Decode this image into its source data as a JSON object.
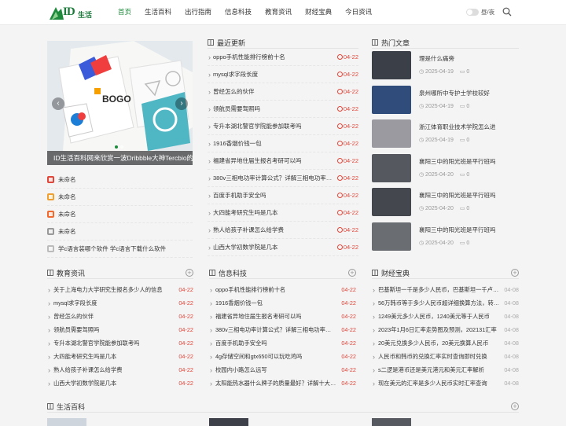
{
  "header": {
    "logo_text": "ID",
    "logo_sub": "生活",
    "nav": [
      "首页",
      "生活百科",
      "出行指南",
      "信息科技",
      "教育资讯",
      "财经宝典",
      "今日资讯"
    ],
    "day_night": "昼/夜",
    "accent": "#1e8b3c"
  },
  "slider": {
    "caption": "ID生活百科网来欣赏一波Dribbble大神Tercbio的作品",
    "prev": "‹",
    "next": "›"
  },
  "sidelist": [
    {
      "label": "未命名",
      "color": "#e0463a"
    },
    {
      "label": "未命名",
      "color": "#f0a030"
    },
    {
      "label": "未命名",
      "color": "#f06a30"
    },
    {
      "label": "未命名",
      "color": "#999999"
    },
    {
      "label": "学c语言装哪个软件 学c语言下载什么软件",
      "color": "#bbbbbb"
    }
  ],
  "latest": {
    "title": "最近更新",
    "items": [
      {
        "t": "oppo手机性能排行榜前十名",
        "d": "04-22"
      },
      {
        "t": "mysql求字段长度",
        "d": "04-22"
      },
      {
        "t": "曾经怎么的伙伴",
        "d": "04-22"
      },
      {
        "t": "领航员需要驾照吗",
        "d": "04-22"
      },
      {
        "t": "专升本湖北警官学院能参加联考吗",
        "d": "04-22"
      },
      {
        "t": "1916香烟价钱一包",
        "d": "04-22"
      },
      {
        "t": "福建省异地住届生报名考研可以吗",
        "d": "04-22"
      },
      {
        "t": "380v三相电功率计算公式？详解三相电功率的计算方法",
        "d": "04-22"
      },
      {
        "t": "百度手机助手安全吗",
        "d": "04-22"
      },
      {
        "t": "大四能考研究生吗是几本",
        "d": "04-22"
      },
      {
        "t": "熟人给孩子补课怎么给学费",
        "d": "04-22"
      },
      {
        "t": "山西大学初数学院是几本",
        "d": "04-22"
      }
    ]
  },
  "hot": {
    "title": "热门文章",
    "items": [
      {
        "t": "理是什么痛旁",
        "date": "2025-04-19",
        "c": "0",
        "bg": "#3a3f48"
      },
      {
        "t": "泉州哪所中专护士学校较好",
        "date": "2025-04-19",
        "c": "0",
        "bg": "#2f4c7a"
      },
      {
        "t": "浙江体育职业技术学院怎么进",
        "date": "2025-04-19",
        "c": "0",
        "bg": "#9a9aa0"
      },
      {
        "t": "襄阳三中的阳光班是平行班吗",
        "date": "2025-04-20",
        "c": "0",
        "bg": "#55585e"
      },
      {
        "t": "襄阳三中的阳光班是平行班吗",
        "date": "2025-04-20",
        "c": "0",
        "bg": "#44474d"
      },
      {
        "t": "襄阳三中的阳光班是平行班吗",
        "date": "2025-04-20",
        "c": "0",
        "bg": "#6a6d72"
      }
    ]
  },
  "edu": {
    "title": "教育资讯",
    "items": [
      {
        "t": "关于上海电力大学研究生报名多少人的信息",
        "d": "04-22"
      },
      {
        "t": "mysql求字段长度",
        "d": "04-22"
      },
      {
        "t": "曾经怎么的伙伴",
        "d": "04-22"
      },
      {
        "t": "领航员需要驾照吗",
        "d": "04-22"
      },
      {
        "t": "专升本湖北警官学院能参加联考吗",
        "d": "04-22"
      },
      {
        "t": "大四能考研究生吗是几本",
        "d": "04-22"
      },
      {
        "t": "熟人给孩子补课怎么给学费",
        "d": "04-22"
      },
      {
        "t": "山西大学初数学院是几本",
        "d": "04-22"
      }
    ]
  },
  "tech": {
    "title": "信息科技",
    "items": [
      {
        "t": "oppo手机性能排行榜前十名",
        "d": "04-22"
      },
      {
        "t": "1916香烟价钱一包",
        "d": "04-22"
      },
      {
        "t": "福建省异地住届生报名考研可以吗",
        "d": "04-22"
      },
      {
        "t": "380v三相电功率计算公式？详解三相电功率的计算方法",
        "d": "04-22"
      },
      {
        "t": "百度手机助手安全吗",
        "d": "04-22"
      },
      {
        "t": "4g存储空间和gtx650可以玩吃鸡吗",
        "d": "04-22"
      },
      {
        "t": "校园内小路怎么远写",
        "d": "04-22"
      },
      {
        "t": "太阳能热水器什么牌子的质量最好？详解十大品牌",
        "d": "04-22"
      }
    ]
  },
  "fin": {
    "title": "财经宝典",
    "items": [
      {
        "t": "巴基斯坦一千是多少人民币，巴基斯坦一千卢比汇率",
        "d": "04-08"
      },
      {
        "t": "56万韩币等于多少人民币超详细换算方法，转存款",
        "d": "04-08"
      },
      {
        "t": "1249美元多少人民币，1240美元等于人民币",
        "d": "04-08"
      },
      {
        "t": "2023年1月6日汇率走势图及预测，202131汇率",
        "d": "04-08"
      },
      {
        "t": "20美元兑换多少人民币，20美元换算人民币",
        "d": "04-08"
      },
      {
        "t": "人民币和韩币的兑换汇率实时查询即时兑换",
        "d": "04-08"
      },
      {
        "t": "s二逻是港币还是美元港元和美元汇率解析",
        "d": "04-08"
      },
      {
        "t": "现在美元的汇率是多少人民币实时汇率查询",
        "d": "04-08"
      }
    ]
  },
  "bottom": {
    "title": "生活百科"
  }
}
